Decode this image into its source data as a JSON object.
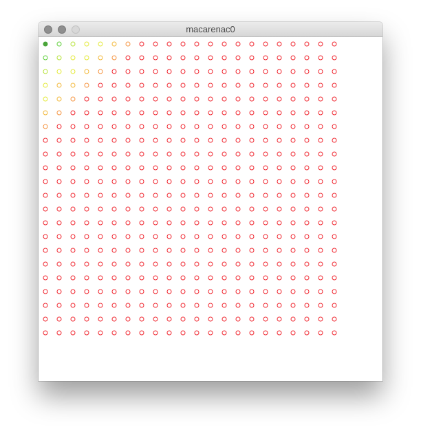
{
  "window": {
    "title": "macarenac0"
  },
  "grid": {
    "rows": 22,
    "cols": 22,
    "colors": {
      "filled_dot": "#4aa53a",
      "green": "#5fcf3a",
      "yellow_green": "#b6e23a",
      "yellow": "#e4ea3a",
      "amber": "#f2b83a",
      "orange": "#f59440",
      "red": "#f0262f"
    },
    "special_cells": [
      {
        "r": 0,
        "c": 0,
        "color": "filled_dot",
        "filled": true
      },
      {
        "r": 0,
        "c": 1,
        "color": "green"
      },
      {
        "r": 0,
        "c": 2,
        "color": "yellow_green"
      },
      {
        "r": 0,
        "c": 3,
        "color": "yellow"
      },
      {
        "r": 0,
        "c": 4,
        "color": "yellow"
      },
      {
        "r": 0,
        "c": 5,
        "color": "amber"
      },
      {
        "r": 0,
        "c": 6,
        "color": "orange"
      },
      {
        "r": 1,
        "c": 0,
        "color": "green"
      },
      {
        "r": 1,
        "c": 1,
        "color": "yellow_green"
      },
      {
        "r": 1,
        "c": 2,
        "color": "yellow"
      },
      {
        "r": 1,
        "c": 3,
        "color": "yellow"
      },
      {
        "r": 1,
        "c": 4,
        "color": "amber"
      },
      {
        "r": 1,
        "c": 5,
        "color": "orange"
      },
      {
        "r": 2,
        "c": 0,
        "color": "yellow_green"
      },
      {
        "r": 2,
        "c": 1,
        "color": "yellow"
      },
      {
        "r": 2,
        "c": 2,
        "color": "yellow"
      },
      {
        "r": 2,
        "c": 3,
        "color": "amber"
      },
      {
        "r": 2,
        "c": 4,
        "color": "orange"
      },
      {
        "r": 3,
        "c": 0,
        "color": "yellow"
      },
      {
        "r": 3,
        "c": 1,
        "color": "amber"
      },
      {
        "r": 3,
        "c": 2,
        "color": "amber"
      },
      {
        "r": 3,
        "c": 3,
        "color": "orange"
      },
      {
        "r": 4,
        "c": 0,
        "color": "yellow"
      },
      {
        "r": 4,
        "c": 1,
        "color": "amber"
      },
      {
        "r": 4,
        "c": 2,
        "color": "orange"
      },
      {
        "r": 5,
        "c": 0,
        "color": "amber"
      },
      {
        "r": 5,
        "c": 1,
        "color": "orange"
      },
      {
        "r": 6,
        "c": 0,
        "color": "orange"
      }
    ]
  }
}
